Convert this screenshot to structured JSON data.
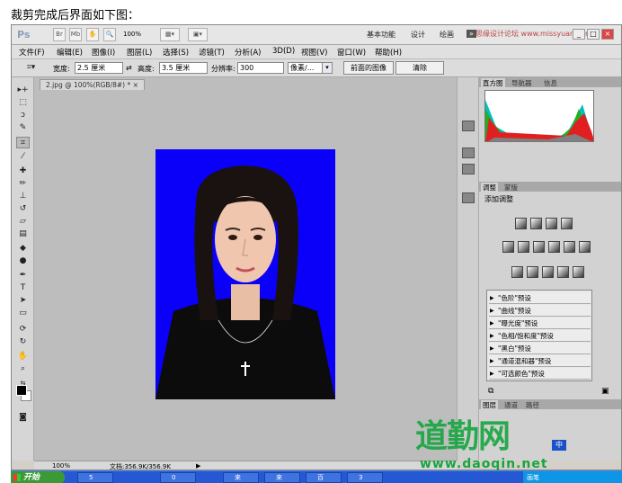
{
  "caption": "裁剪完成后界面如下图：",
  "titlebar": {
    "logo": "Ps",
    "zoom": "100%",
    "workspaces": [
      "基本功能",
      "设计",
      "绘画"
    ],
    "watermark": "思缘设计论坛 www.missyuan.com"
  },
  "menu": [
    "文件(F)",
    "编辑(E)",
    "图像(I)",
    "图层(L)",
    "选择(S)",
    "滤镜(T)",
    "分析(A)",
    "3D(D)",
    "视图(V)",
    "窗口(W)",
    "帮助(H)"
  ],
  "options": {
    "width_label": "宽度:",
    "width_value": "2.5 厘米",
    "height_label": "高度:",
    "height_value": "3.5 厘米",
    "resolution_label": "分辨率:",
    "resolution_value": "300",
    "unit_value": "像素/...",
    "front_image_button": "前面的图像",
    "clear_button": "清除"
  },
  "document": {
    "tab_title": "2.jpg @ 100%(RGB/8#) *",
    "status_zoom": "100%",
    "status_doc": "文档:356.9K/356.9K",
    "canvas_bg": "#0a00fa"
  },
  "panels": {
    "top_tabs": [
      "直方图",
      "导航器",
      "信息"
    ],
    "adj_tabs": [
      "调整",
      "蒙版"
    ],
    "adj_title": "添加调整",
    "presets": [
      "\"色阶\"预设",
      "\"曲线\"预设",
      "\"曝光度\"预设",
      "\"色相/饱和度\"预设",
      "\"黑白\"预设",
      "\"通道混和器\"预设",
      "\"可选颜色\"预设"
    ],
    "bottom_tabs": [
      "图层",
      "通道",
      "路径"
    ]
  },
  "taskbar": {
    "start": "开始",
    "tasks": [
      "5",
      "0",
      "来",
      "来",
      "百",
      "3"
    ],
    "tray": "画笔"
  },
  "watermark": {
    "big": "道勤网",
    "url": "www.daoqin.net",
    "ime": "中"
  }
}
